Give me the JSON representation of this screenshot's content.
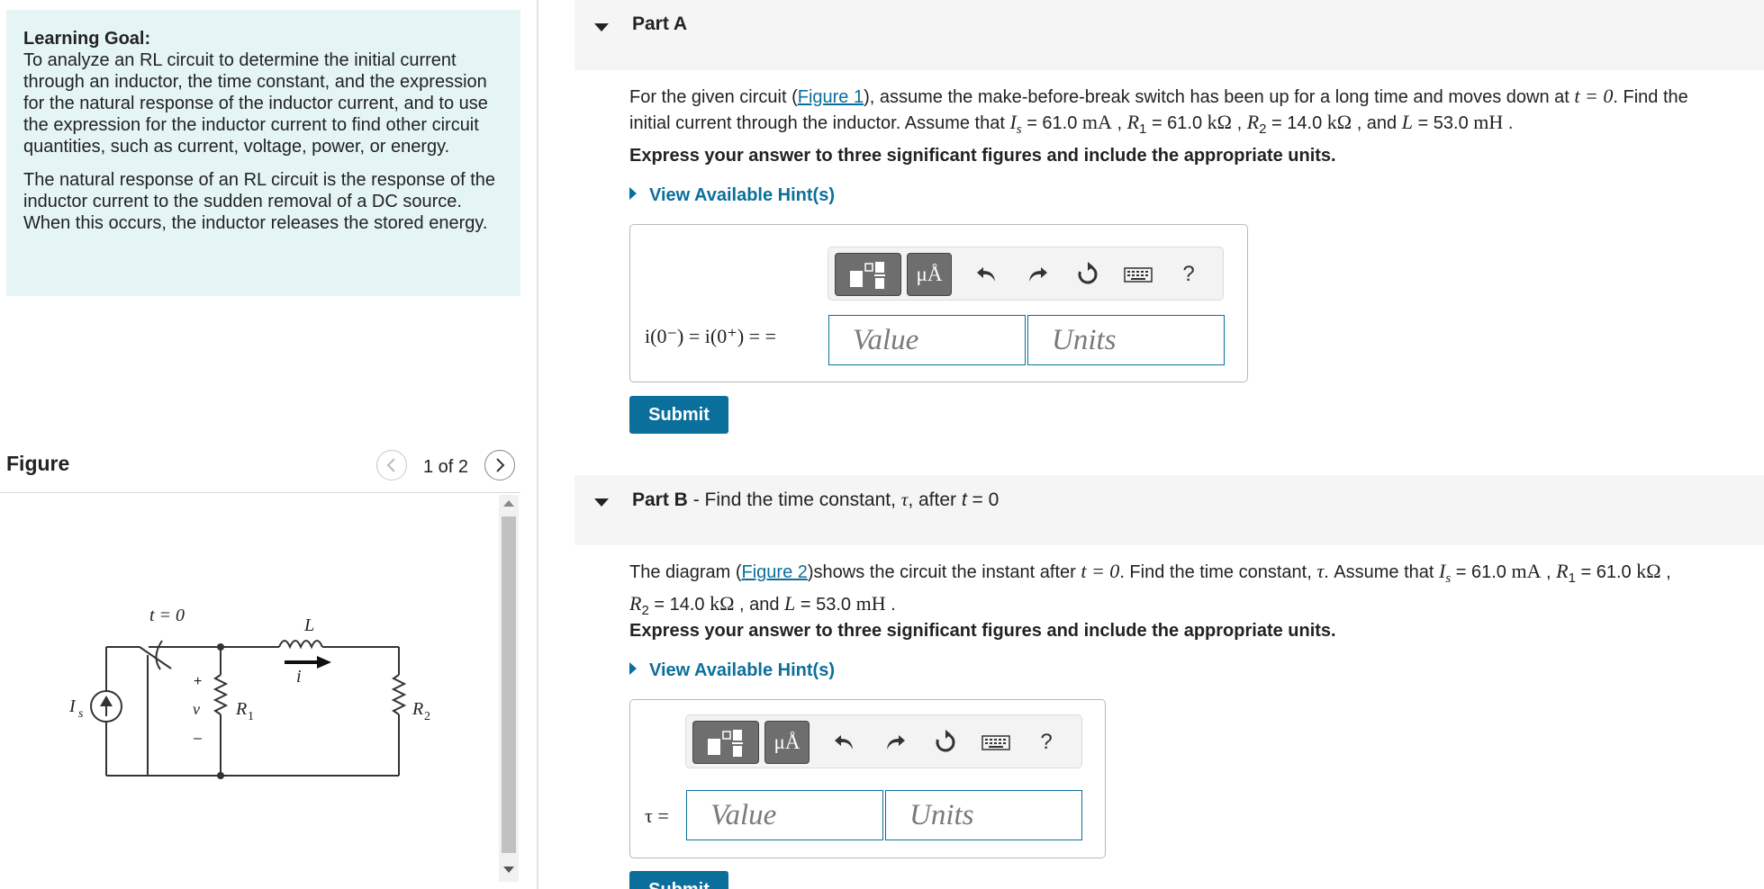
{
  "learning_goal": {
    "title": "Learning Goal:",
    "text1": "To analyze an RL circuit to determine the initial current through an inductor, the time constant, and the expression for the natural response of the inductor current, and to use the expression for the inductor current to find other circuit quantities, such as current, voltage, power, or energy.",
    "text2": "The natural response of an RL circuit is the response of the inductor current to the sudden removal of a DC source. When this occurs, the inductor releases the stored energy."
  },
  "figure": {
    "title": "Figure",
    "counter": "1 of 2",
    "labels": {
      "t0": "t = 0",
      "L": "L",
      "i": "i",
      "Is": "I",
      "Is_sub": "s",
      "v": "v",
      "plus": "+",
      "minus": "–",
      "R1": "R",
      "R1_sub": "1",
      "R2": "R",
      "R2_sub": "2"
    }
  },
  "part_a": {
    "label": "Part A",
    "q_pre": "For the given circuit (",
    "link": "Figure 1",
    "q_mid": "), assume the make-before-break switch has been up for a long time and moves down at ",
    "t_eq": "t = 0",
    "q_post": ". Find the",
    "q_line2_pre": "initial current through the inductor. Assume that ",
    "Is_sym": "I",
    "Is_sub": "s",
    "Is_val": " = 61.0 ",
    "Is_unit": "mA",
    "sep1": " , ",
    "R1_sym": "R",
    "R1_sub": "1",
    "R1_val": " = 61.0 ",
    "R1_unit": "kΩ",
    "sep2": " , ",
    "R2_sym": "R",
    "R2_sub": "2",
    "R2_val": " = 14.0 ",
    "R2_unit": "kΩ",
    "sep3": " , and ",
    "L_sym": "L",
    "L_val": " = 53.0 ",
    "L_unit": "mH",
    "end": " .",
    "instruction": "Express your answer to three significant figures and include the appropriate units.",
    "hint": "View Available Hint(s)",
    "answer_label": "i(0⁻) = i(0⁺) = =",
    "value_placeholder": "Value",
    "units_placeholder": "Units",
    "toolbar": {
      "mu_label": "μÅ",
      "help": "?"
    },
    "submit": "Submit"
  },
  "part_b": {
    "label": "Part B",
    "dash": " - Find the time constant, ",
    "tau": "τ",
    "after": ", after ",
    "t_sym": "t",
    "t_eq": " = 0",
    "q_pre": "The diagram (",
    "link": "Figure 2",
    "q_mid": ")shows the circuit the instant after ",
    "t_eq_q": "t = 0",
    "q_mid2": ". Find the time constant, ",
    "q_tau": "τ",
    "q_mid3": ". Assume that ",
    "Is_sym": "I",
    "Is_sub": "s",
    "Is_val": " = 61.0 ",
    "Is_unit": "mA",
    "sep1": " , ",
    "R1_sym": "R",
    "R1_sub": "1",
    "R1_val": " = 61.0 ",
    "R1_unit": "kΩ",
    "sep2": " ,",
    "R2_sym": "R",
    "R2_sub": "2",
    "R2_val": " = 14.0 ",
    "R2_unit": "kΩ",
    "sep3": " , and ",
    "L_sym": "L",
    "L_val": " = 53.0 ",
    "L_unit": "mH",
    "end": " .",
    "instruction": "Express your answer to three significant figures and include the appropriate units.",
    "hint": "View Available Hint(s)",
    "answer_label": "τ =",
    "value_placeholder": "Value",
    "units_placeholder": "Units",
    "toolbar": {
      "mu_label": "μÅ",
      "help": "?"
    },
    "submit": "Submit"
  },
  "colors": {
    "accent": "#0b6f9c",
    "goal_bg": "#e5f5f5",
    "part_header_bg": "#f5f5f5"
  }
}
